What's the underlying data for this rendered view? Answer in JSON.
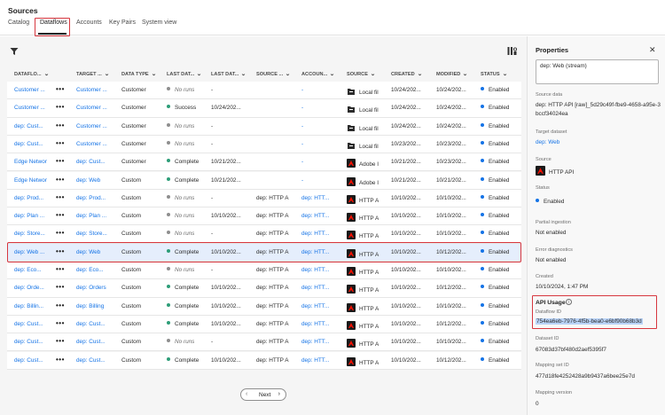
{
  "header": {
    "title": "Sources",
    "tabs": [
      "Catalog",
      "Dataflows",
      "Accounts",
      "Key Pairs",
      "System view"
    ]
  },
  "table": {
    "columns": [
      "DATAFLO...",
      "TARGET ...",
      "DATA TYPE",
      "LAST DAT...",
      "LAST DAT...",
      "SOURCE ...",
      "ACCOUN...",
      "SOURCE",
      "CREATED",
      "MODIFIED",
      "STATUS"
    ],
    "rows": [
      {
        "name": "Customer ...",
        "target": "Customer ...",
        "type": "Customer",
        "run": "No runs",
        "run_state": "none",
        "last": "-",
        "src_ds": "",
        "account": "-",
        "source": "Local fil",
        "src_icon": "local",
        "created": "10/24/202...",
        "modified": "10/24/202...",
        "status": "Enabled"
      },
      {
        "name": "Customer ...",
        "target": "Customer ...",
        "type": "Customer",
        "run": "Success",
        "run_state": "success",
        "last": "10/24/202...",
        "src_ds": "",
        "account": "-",
        "source": "Local fil",
        "src_icon": "local",
        "created": "10/24/202...",
        "modified": "10/24/202...",
        "status": "Enabled"
      },
      {
        "name": "dep: Cust...",
        "target": "Customer ...",
        "type": "Customer",
        "run": "No runs",
        "run_state": "none",
        "last": "-",
        "src_ds": "",
        "account": "-",
        "source": "Local fil",
        "src_icon": "local",
        "created": "10/24/202...",
        "modified": "10/24/202...",
        "status": "Enabled"
      },
      {
        "name": "dep: Cust...",
        "target": "Customer ...",
        "type": "Customer",
        "run": "No runs",
        "run_state": "none",
        "last": "-",
        "src_ds": "",
        "account": "-",
        "source": "Local fil",
        "src_icon": "local",
        "created": "10/23/202...",
        "modified": "10/23/202...",
        "status": "Enabled"
      },
      {
        "name": "Edge Networ",
        "target": "dep: Cust...",
        "type": "Customer",
        "run": "Complete",
        "run_state": "success",
        "last": "10/21/202...",
        "src_ds": "",
        "account": "-",
        "source": "Adobe I",
        "src_icon": "adobe",
        "created": "10/21/202...",
        "modified": "10/23/202...",
        "status": "Enabled"
      },
      {
        "name": "Edge Networ",
        "target": "dep: Web",
        "type": "Custom",
        "run": "Complete",
        "run_state": "success",
        "last": "10/21/202...",
        "src_ds": "",
        "account": "-",
        "source": "Adobe I",
        "src_icon": "adobe",
        "created": "10/21/202...",
        "modified": "10/21/202...",
        "status": "Enabled"
      },
      {
        "name": "dep: Prod...",
        "target": "dep: Prod...",
        "type": "Custom",
        "run": "No runs",
        "run_state": "none",
        "last": "-",
        "src_ds": "dep: HTTP A",
        "account": "dep: HTT...",
        "source": "HTTP A",
        "src_icon": "adobe",
        "created": "10/10/202...",
        "modified": "10/10/202...",
        "status": "Enabled"
      },
      {
        "name": "dep: Plan ...",
        "target": "dep: Plan ...",
        "type": "Custom",
        "run": "No runs",
        "run_state": "none",
        "last": "10/10/202...",
        "src_ds": "dep: HTTP A",
        "account": "dep: HTT...",
        "source": "HTTP A",
        "src_icon": "adobe",
        "created": "10/10/202...",
        "modified": "10/10/202...",
        "status": "Enabled"
      },
      {
        "name": "dep: Store...",
        "target": "dep: Store...",
        "type": "Custom",
        "run": "No runs",
        "run_state": "none",
        "last": "-",
        "src_ds": "dep: HTTP A",
        "account": "dep: HTT...",
        "source": "HTTP A",
        "src_icon": "adobe",
        "created": "10/10/202...",
        "modified": "10/10/202...",
        "status": "Enabled"
      },
      {
        "name": "dep: Web ...",
        "target": "dep: Web",
        "type": "Custom",
        "run": "Complete",
        "run_state": "success",
        "last": "10/10/202...",
        "src_ds": "dep: HTTP A",
        "account": "dep: HTT...",
        "source": "HTTP A",
        "src_icon": "adobe",
        "created": "10/10/202...",
        "modified": "10/12/202...",
        "status": "Enabled",
        "selected": true
      },
      {
        "name": "dep: Eco...",
        "target": "dep: Eco...",
        "type": "Custom",
        "run": "No runs",
        "run_state": "none",
        "last": "-",
        "src_ds": "dep: HTTP A",
        "account": "dep: HTT...",
        "source": "HTTP A",
        "src_icon": "adobe",
        "created": "10/10/202...",
        "modified": "10/10/202...",
        "status": "Enabled"
      },
      {
        "name": "dep: Orde...",
        "target": "dep: Orders",
        "type": "Custom",
        "run": "Complete",
        "run_state": "success",
        "last": "10/10/202...",
        "src_ds": "dep: HTTP A",
        "account": "dep: HTT...",
        "source": "HTTP A",
        "src_icon": "adobe",
        "created": "10/10/202...",
        "modified": "10/12/202...",
        "status": "Enabled"
      },
      {
        "name": "dep: Billin...",
        "target": "dep: Billing",
        "type": "Custom",
        "run": "Complete",
        "run_state": "success",
        "last": "10/10/202...",
        "src_ds": "dep: HTTP A",
        "account": "dep: HTT...",
        "source": "HTTP A",
        "src_icon": "adobe",
        "created": "10/10/202...",
        "modified": "10/10/202...",
        "status": "Enabled"
      },
      {
        "name": "dep: Cust...",
        "target": "dep: Cust...",
        "type": "Custom",
        "run": "Complete",
        "run_state": "success",
        "last": "10/10/202...",
        "src_ds": "dep: HTTP A",
        "account": "dep: HTT...",
        "source": "HTTP A",
        "src_icon": "adobe",
        "created": "10/10/202...",
        "modified": "10/12/202...",
        "status": "Enabled"
      },
      {
        "name": "dep: Cust...",
        "target": "dep: Cust...",
        "type": "Custom",
        "run": "No runs",
        "run_state": "none",
        "last": "-",
        "src_ds": "dep: HTTP A",
        "account": "dep: HTT...",
        "source": "HTTP A",
        "src_icon": "adobe",
        "created": "10/10/202...",
        "modified": "10/10/202...",
        "status": "Enabled"
      },
      {
        "name": "dep: Cust...",
        "target": "dep: Cust...",
        "type": "Custom",
        "run": "Complete",
        "run_state": "success",
        "last": "10/10/202...",
        "src_ds": "dep: HTTP A",
        "account": "dep: HTT...",
        "source": "HTTP A",
        "src_icon": "adobe",
        "created": "10/10/202...",
        "modified": "10/12/202...",
        "status": "Enabled"
      }
    ]
  },
  "pagination": {
    "next_label": "Next"
  },
  "panel": {
    "title": "Properties",
    "description_value": "dep: Web (stream)",
    "source_data_label": "Source data",
    "source_data_value": "dep: HTTP API [raw]_5d29c49f-fbe9-4658-a95e-3bccf34024ea",
    "target_dataset_label": "Target dataset",
    "target_dataset_value": "dep: Web",
    "source_label": "Source",
    "source_value": "HTTP API",
    "status_label": "Status",
    "status_value": "Enabled",
    "partial_label": "Partial ingestion",
    "partial_value": "Not enabled",
    "error_label": "Error diagnostics",
    "error_value": "Not enabled",
    "created_label": "Created",
    "created_value": "10/10/2024, 1:47 PM",
    "api_title": "API Usage",
    "dataflow_id_label": "Dataflow ID",
    "dataflow_id_value": "754ea6eb-7976-4f5b-bea0-e6bf90b68b3d",
    "dataset_id_label": "Dataset ID",
    "dataset_id_value": "67083d37bf480d2aef5395f7",
    "mapping_set_label": "Mapping set ID",
    "mapping_set_value": "477d18fe4252428a9b9437a6bee25e7d",
    "mapping_version_label": "Mapping version",
    "mapping_version_value": "0"
  },
  "colors": {
    "accent": "#1473e6",
    "highlight_red": "#d7373f",
    "success": "#2d9d78",
    "neutral": "#8e8e8e"
  }
}
